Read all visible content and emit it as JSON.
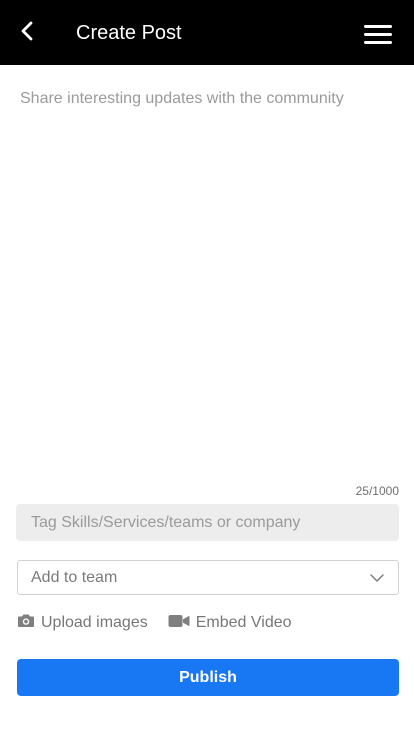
{
  "header": {
    "title": "Create Post",
    "back_icon": "chevron-left-icon",
    "menu_icon": "hamburger-menu-icon",
    "background": "#000000"
  },
  "post": {
    "placeholder": "Share interesting updates with the community",
    "value": "",
    "counter": "25/1000"
  },
  "tag": {
    "placeholder": "Tag Skills/Services/teams or company"
  },
  "team_select": {
    "label": "Add to team",
    "icon": "chevron-down-icon"
  },
  "media": {
    "upload_label": "Upload images",
    "upload_icon": "camera-icon",
    "embed_label": "Embed Video",
    "embed_icon": "video-camera-icon"
  },
  "publish": {
    "label": "Publish",
    "color": "#1877f2"
  }
}
